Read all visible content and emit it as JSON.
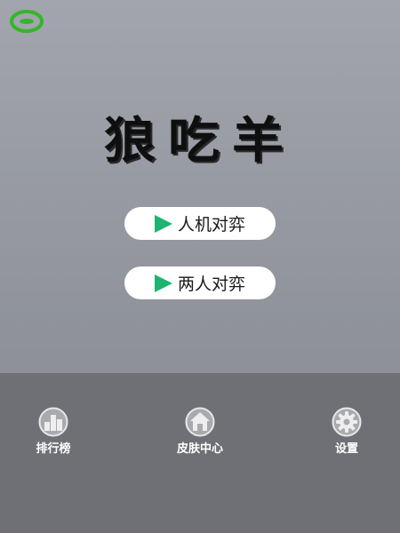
{
  "app": {
    "title": "狼吃羊"
  },
  "menu": {
    "vs_ai_label": "人机对弈",
    "two_player_label": "两人对弈"
  },
  "nav": {
    "items": [
      {
        "label": "排行榜",
        "icon": "leaderboard-icon"
      },
      {
        "label": "皮肤中心",
        "icon": "house-icon"
      },
      {
        "label": "设置",
        "icon": "gear-icon"
      }
    ]
  },
  "colors": {
    "background": "#979aa2",
    "bottom_bar": "#6e7076",
    "button_bg": "#ffffff",
    "play_accent": "#1db472",
    "corner_icon": "#35b52a"
  }
}
